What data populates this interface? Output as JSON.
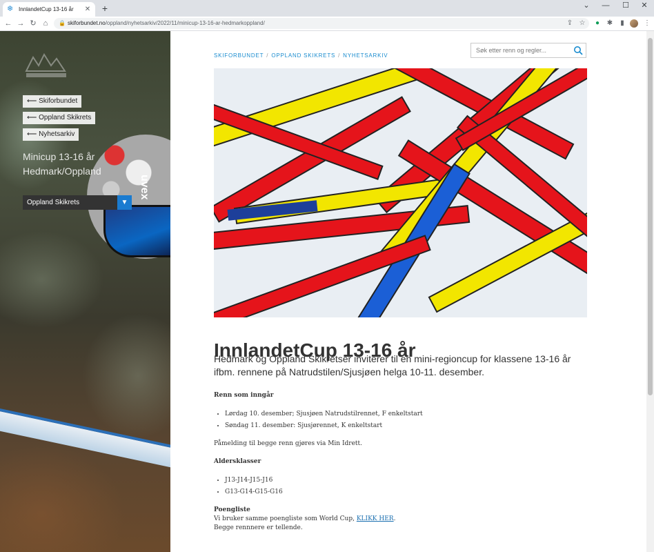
{
  "browser": {
    "tab_title": "InnlandetCup 13-16 år",
    "new_tab_icon": "plus-icon",
    "url_host": "skiforbundet.no",
    "url_path": "/oppland/nyhetsarkiv/2022/11/minicup-13-16-ar-hedmarkoppland/"
  },
  "sidebar": {
    "nav_buttons": [
      {
        "label": "⟵ Skiforbundet"
      },
      {
        "label": "⟵ Oppland Skikrets"
      },
      {
        "label": "⟵ Nyhetsarkiv"
      }
    ],
    "page_title": "Minicup 13-16 år Hedmark/Oppland",
    "region_select": {
      "value": "Oppland Skikrets"
    },
    "helmet_brand": "uvex"
  },
  "header": {
    "breadcrumb": [
      "SKIFORBUNDET",
      "OPPLAND SKIKRETS",
      "NYHETSARKIV"
    ],
    "search_placeholder": "Søk etter renn og regler..."
  },
  "article": {
    "title": "InnlandetCup 13-16 år",
    "lead": "Hedmark og Oppland Skikretser inviterer til en mini-regioncup for klassene 13-16 år ifbm. rennene på Natrudstilen/Sjusjøen helga 10-11. desember.",
    "section1_heading": "Renn som inngår",
    "races": [
      "Lørdag 10. desember; Sjusjøen Natrudstilrennet, F enkeltstart",
      "Søndag 11. desember: Sjusjørennet, K enkeltstart"
    ],
    "registration": "Påmelding til begge renn gjøres via Min Idrett.",
    "section2_heading": "Aldersklasser",
    "classes": [
      "J13-J14-J15-J16",
      "G13-G14-G15-G16"
    ],
    "section3_heading": "Poengliste",
    "points_text": "Vi bruker samme poengliste som World Cup, ",
    "points_link": "KLIKK HER",
    "points_after": ".",
    "both_count": "Begge rennnere er tellende."
  },
  "colors": {
    "accent": "#1a8ccf",
    "select_caret": "#1a7bd0"
  }
}
